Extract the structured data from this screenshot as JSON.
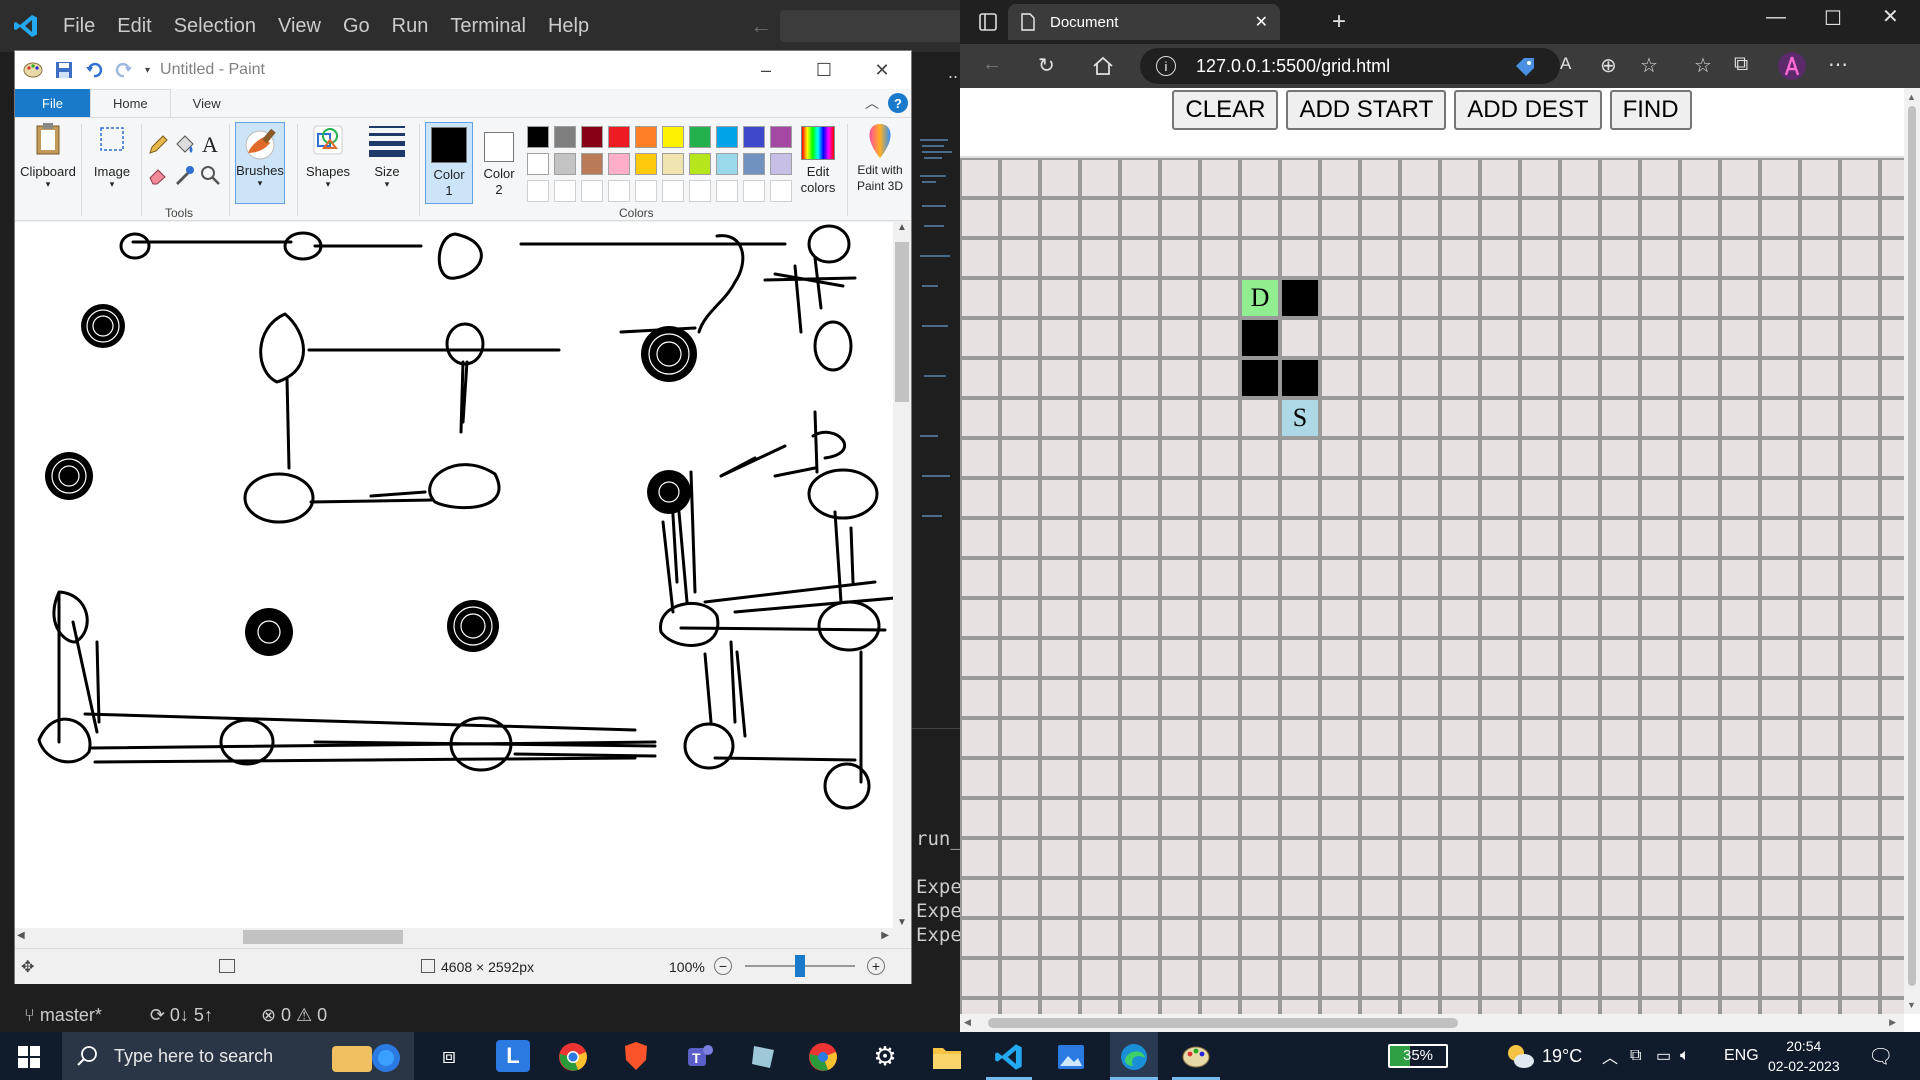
{
  "vscode": {
    "menu": [
      "File",
      "Edit",
      "Selection",
      "View",
      "Go",
      "Run",
      "Terminal",
      "Help"
    ],
    "nav": "← →",
    "dots": "..",
    "terminal_lines": [
      "run_",
      "Expe",
      "Expe",
      "Expe"
    ],
    "status": {
      "branch": "master*",
      "sync": "0↓ 5↑",
      "problems": "⊗ 0 ⚠ 0"
    }
  },
  "paint": {
    "title": "Untitled - Paint",
    "tabs": {
      "file": "File",
      "home": "Home",
      "view": "View"
    },
    "ribbon": {
      "clipboard": "Clipboard",
      "image": "Image",
      "tools_label": "Tools",
      "brushes": "Brushes",
      "shapes": "Shapes",
      "size": "Size",
      "color1": "Color 1",
      "color2": "Color 2",
      "colors_label": "Colors",
      "edit_colors": "Edit colors",
      "edit_paint3d": "Edit with Paint 3D"
    },
    "palette_row1": [
      "#000000",
      "#7f7f7f",
      "#880015",
      "#ed1c24",
      "#ff7f27",
      "#fff200",
      "#22b14c",
      "#00a2e8",
      "#3f48cc",
      "#a349a4"
    ],
    "palette_row2": [
      "#ffffff",
      "#c3c3c3",
      "#b97a57",
      "#ffaec9",
      "#ffc90e",
      "#efe4b0",
      "#b5e61d",
      "#99d9ea",
      "#7092be",
      "#c8bfe7"
    ],
    "status": {
      "dimensions": "4608 × 2592px",
      "zoom": "100%",
      "zoom_level": 0.5
    }
  },
  "edge": {
    "tab_title": "Document",
    "url": "127.0.0.1:5500/grid.html",
    "buttons": [
      "CLEAR",
      "ADD START",
      "ADD DEST",
      "FIND"
    ],
    "grid": {
      "cols": 24,
      "rows": 22,
      "empty_color": "#e7e1e1",
      "wall_color": "#000000",
      "start_color": "#add8e6",
      "dest_color": "#90ee90",
      "walls": [
        [
          3,
          7
        ],
        [
          3,
          8
        ],
        [
          4,
          7
        ],
        [
          5,
          7
        ],
        [
          5,
          8
        ]
      ],
      "dest": {
        "row": 3,
        "col": 7,
        "label": "D"
      },
      "start": {
        "row": 6,
        "col": 8,
        "label": "S"
      }
    }
  },
  "taskbar": {
    "search_placeholder": "Type here to search",
    "battery": "35%",
    "weather": "19°C",
    "lang": "ENG",
    "time": "20:54",
    "date": "02-02-2023"
  }
}
